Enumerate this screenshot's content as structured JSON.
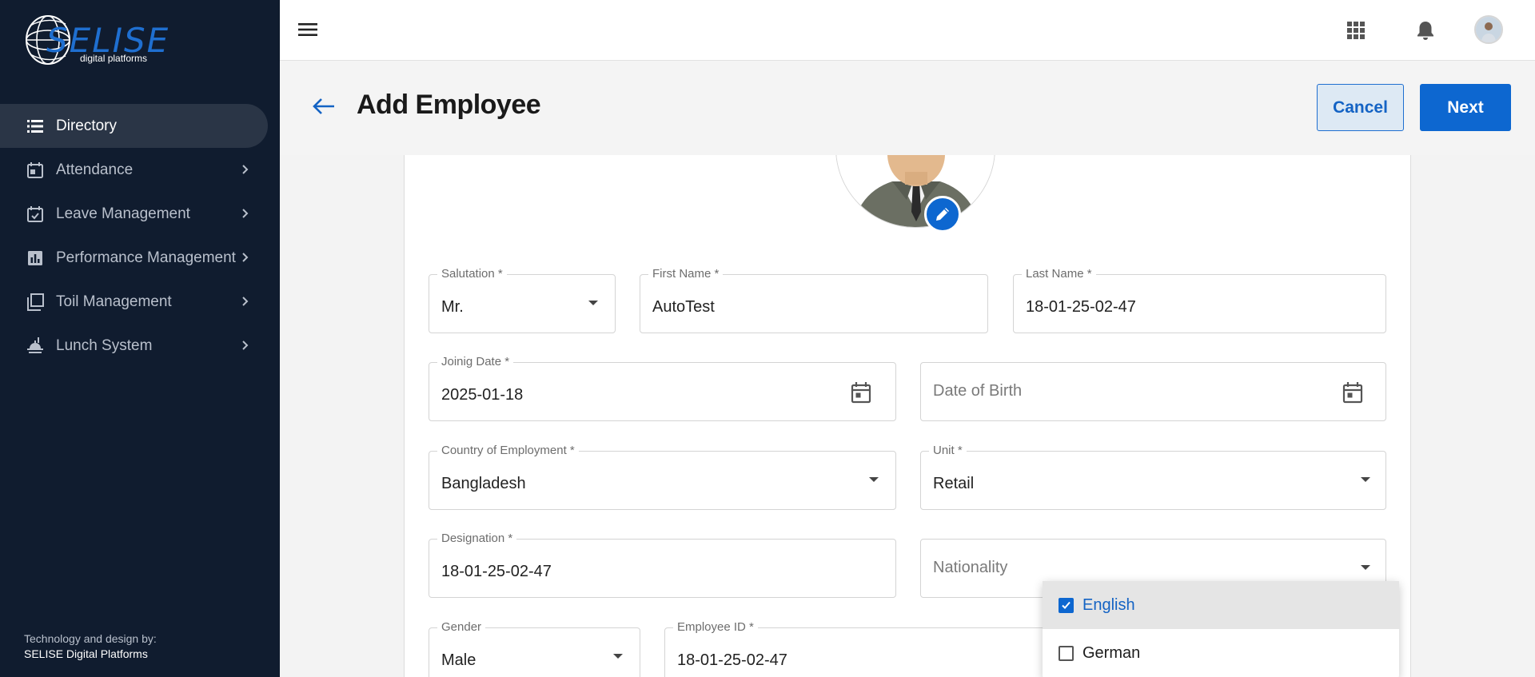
{
  "brand": {
    "name": "SELISE",
    "tagline": "digital platforms"
  },
  "sidebar": {
    "items": [
      {
        "label": "Directory",
        "icon": "list-icon",
        "active": true
      },
      {
        "label": "Attendance",
        "icon": "calendar-icon"
      },
      {
        "label": "Leave Management",
        "icon": "calendar-check-icon"
      },
      {
        "label": "Performance Management",
        "icon": "bar-chart-icon"
      },
      {
        "label": "Toil Management",
        "icon": "stack-icon"
      },
      {
        "label": "Lunch System",
        "icon": "food-icon"
      }
    ],
    "footer_line1": "Technology and design by:",
    "footer_line2": "SELISE Digital Platforms"
  },
  "header": {
    "title": "Add Employee",
    "cancel_label": "Cancel",
    "next_label": "Next"
  },
  "form": {
    "salutation": {
      "label": "Salutation *",
      "value": "Mr."
    },
    "first_name": {
      "label": "First Name *",
      "value": "AutoTest"
    },
    "last_name": {
      "label": "Last Name *",
      "value": "18-01-25-02-47"
    },
    "joining_date": {
      "label": "Joinig Date *",
      "value": "2025-01-18"
    },
    "date_of_birth": {
      "placeholder": "Date of Birth"
    },
    "country": {
      "label": "Country of Employment *",
      "value": "Bangladesh"
    },
    "unit": {
      "label": "Unit *",
      "value": "Retail"
    },
    "designation": {
      "label": "Designation *",
      "value": "18-01-25-02-47"
    },
    "nationality": {
      "placeholder": "Nationality"
    },
    "gender": {
      "label": "Gender",
      "value": "Male"
    },
    "employee_id": {
      "label": "Employee ID *",
      "value": "18-01-25-02-47"
    }
  },
  "language_dropdown": {
    "options": [
      {
        "label": "English",
        "checked": true
      },
      {
        "label": "German",
        "checked": false
      }
    ]
  },
  "colors": {
    "sidebar_bg": "#101c2f",
    "primary": "#0d67d0",
    "active_item_bg": "#2a3546"
  }
}
